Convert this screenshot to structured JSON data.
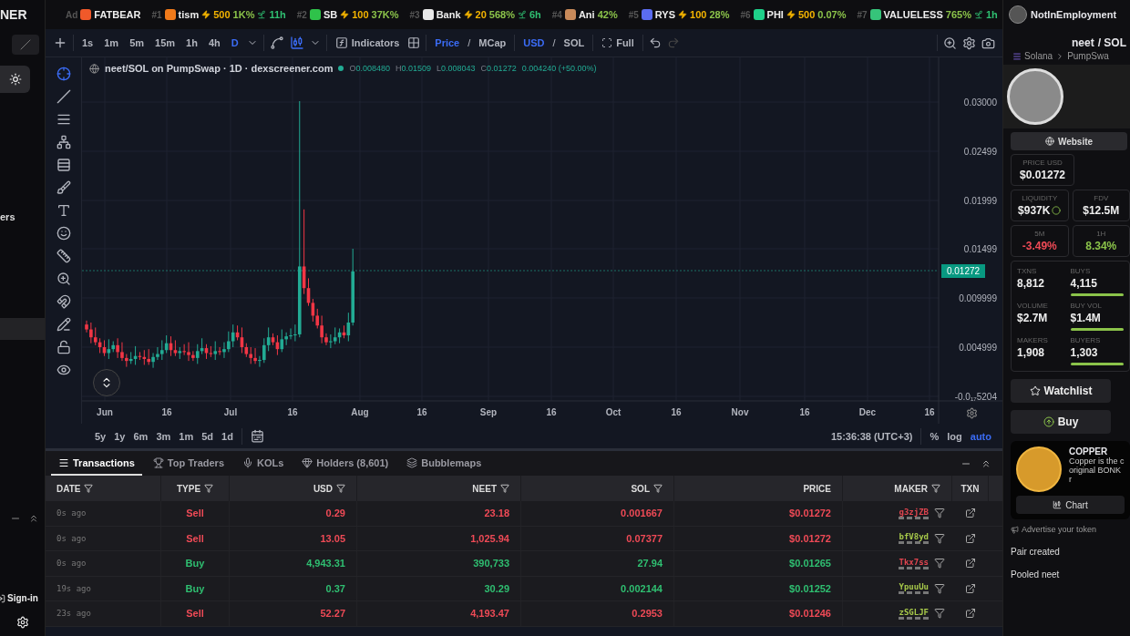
{
  "sidebar": {
    "logo": "NER",
    "label": "ers",
    "sign_in": "Sign-in"
  },
  "ticker": {
    "items": [
      {
        "rank": "Ad",
        "name": "FATBEAR",
        "color": "#f0592a"
      },
      {
        "rank": "#1",
        "name": "tism",
        "boost": "500",
        "change": "1K%",
        "age": "11h",
        "color": "#f07a1a"
      },
      {
        "rank": "#2",
        "name": "SB",
        "boost": "100",
        "change": "37K%",
        "color": "#2fc24a"
      },
      {
        "rank": "#3",
        "name": "Bank",
        "boost": "20",
        "change": "568%",
        "age": "6h",
        "color": "#e8e8e8"
      },
      {
        "rank": "#4",
        "name": "Ani",
        "change": "42%",
        "color": "#c98a5a"
      },
      {
        "rank": "#5",
        "name": "RYS",
        "boost": "100",
        "change": "28%",
        "color": "#5b6cf0"
      },
      {
        "rank": "#6",
        "name": "PHI",
        "boost": "500",
        "change": "0.07%",
        "color": "#1fd08a"
      },
      {
        "rank": "#7",
        "name": "VALUELESS",
        "change": "765%",
        "age": "1h",
        "color": "#36c47a"
      }
    ]
  },
  "toolbar": {
    "timeframes": [
      {
        "label": "1s",
        "selected": false
      },
      {
        "label": "1m",
        "selected": false
      },
      {
        "label": "5m",
        "selected": false
      },
      {
        "label": "15m",
        "selected": false
      },
      {
        "label": "1h",
        "selected": false
      },
      {
        "label": "4h",
        "selected": false
      },
      {
        "label": "D",
        "selected": true
      }
    ],
    "indicators": "Indicators",
    "price_mode": [
      {
        "label": "Price",
        "selected": true
      },
      {
        "label": "MCap",
        "selected": false
      }
    ],
    "currency": [
      {
        "label": "USD",
        "selected": true
      },
      {
        "label": "SOL",
        "selected": false
      }
    ],
    "separator": "/",
    "full": "Full"
  },
  "chart": {
    "title": "neet/SOL on PumpSwap · 1D · dexscreener.com",
    "ohlc": [
      {
        "key": "O",
        "value": "0.008480"
      },
      {
        "key": "H",
        "value": "0.01509"
      },
      {
        "key": "L",
        "value": "0.008043"
      },
      {
        "key": "C",
        "value": "0.01272"
      }
    ],
    "change": "0.004240 (+50.00%)",
    "price_labels": [
      "0.03000",
      "0.02499",
      "0.01999",
      "0.01499",
      "0.009999",
      "0.004999",
      "-0.0₁₇5204"
    ],
    "current_price": "0.01272",
    "time_labels": [
      "Jun",
      "16",
      "Jul",
      "16",
      "Aug",
      "16",
      "Sep",
      "16",
      "Oct",
      "16",
      "Nov",
      "16",
      "Dec",
      "16"
    ],
    "ranges": [
      "5y",
      "1y",
      "6m",
      "3m",
      "1m",
      "5d",
      "1d"
    ],
    "clock": "15:36:38 (UTC+3)",
    "scale_options": [
      {
        "label": "%",
        "selected": false
      },
      {
        "label": "log",
        "selected": false
      },
      {
        "label": "auto",
        "selected": true
      }
    ]
  },
  "tabs": [
    {
      "label": "Transactions",
      "selected": true,
      "kind": "list"
    },
    {
      "label": "Top Traders",
      "selected": false,
      "kind": "trophy"
    },
    {
      "label": "KOLs",
      "selected": false,
      "kind": "mic"
    },
    {
      "label": "Holders (8,601)",
      "selected": false,
      "kind": "gem"
    },
    {
      "label": "Bubblemaps",
      "selected": false,
      "kind": "bubbles"
    }
  ],
  "table": {
    "columns": [
      "DATE",
      "TYPE",
      "USD",
      "NEET",
      "SOL",
      "PRICE",
      "MAKER",
      "TXN"
    ],
    "rows": [
      {
        "date": "0s ago",
        "type": "Sell",
        "kind": "sell",
        "usd": "0.29",
        "neet": "23.18",
        "sol": "0.001667",
        "price": "$0.01272",
        "maker": "g3zjZB",
        "color": "#e0454f"
      },
      {
        "date": "0s ago",
        "type": "Sell",
        "kind": "sell",
        "usd": "13.05",
        "neet": "1,025.94",
        "sol": "0.07377",
        "price": "$0.01272",
        "maker": "bfV8yd",
        "color": "#a7c94a"
      },
      {
        "date": "0s ago",
        "type": "Buy",
        "kind": "buy",
        "usd": "4,943.31",
        "neet": "390,733",
        "sol": "27.94",
        "price": "$0.01265",
        "maker": "Tkx7ss",
        "color": "#e0454f"
      },
      {
        "date": "19s ago",
        "type": "Buy",
        "kind": "buy",
        "usd": "0.37",
        "neet": "30.29",
        "sol": "0.002144",
        "price": "$0.01252",
        "maker": "YpuuUu",
        "color": "#a7c94a"
      },
      {
        "date": "23s ago",
        "type": "Sell",
        "kind": "sell",
        "usd": "52.27",
        "neet": "4,193.47",
        "sol": "0.2953",
        "price": "$0.01246",
        "maker": "zSGLJF",
        "color": "#a7c94a"
      }
    ]
  },
  "panel": {
    "user": "NotInEmployment",
    "pair_base": "neet",
    "pair_quote": "/ SOL",
    "chain": "Solana",
    "dex": "PumpSwa",
    "website": "Website",
    "price_label": "PRICE USD",
    "price": "$0.01272",
    "stats": [
      {
        "label": "LIQUIDITY",
        "value": "$937K"
      },
      {
        "label": "FDV",
        "value": "$12.5M"
      }
    ],
    "changes": [
      {
        "label": "5M",
        "value": "-3.49%",
        "kind": "down"
      },
      {
        "label": "1H",
        "value": "8.34%",
        "kind": "up"
      }
    ],
    "counts": [
      {
        "label": "TXNS",
        "value": "8,812"
      },
      {
        "label": "BUYS",
        "value": "4,115"
      },
      {
        "label": "VOLUME",
        "value": "$2.7M"
      },
      {
        "label": "BUY VOL",
        "value": "$1.4M"
      },
      {
        "label": "MAKERS",
        "value": "1,908"
      },
      {
        "label": "BUYERS",
        "value": "1,303"
      }
    ],
    "watchlist": "Watchlist",
    "buy": "Buy",
    "ad": {
      "title": "COPPER",
      "lines": [
        "Copper is the c",
        "original BONK r"
      ],
      "button": "Chart"
    },
    "advertise": "Advertise your token",
    "info": [
      "Pair created",
      "Pooled neet"
    ]
  }
}
